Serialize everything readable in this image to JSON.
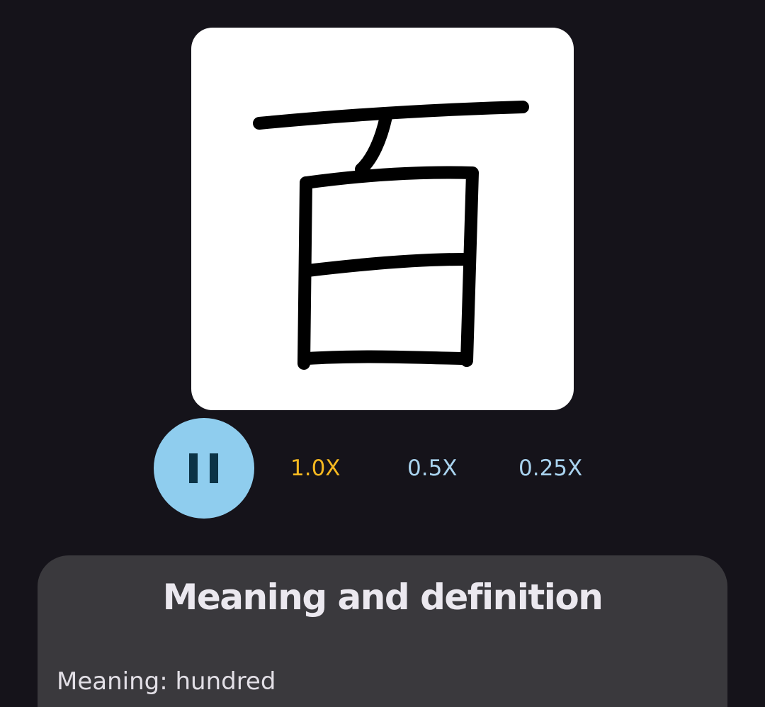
{
  "kanji": {
    "character": "百",
    "stroke_color": "#000000",
    "card_color": "#ffffff"
  },
  "player": {
    "state": "playing",
    "pause_icon": "pause-icon",
    "button_color": "#8fcdee",
    "speeds": [
      {
        "label": "1.0X",
        "selected": true,
        "color": "#f5b820"
      },
      {
        "label": "0.5X",
        "selected": false,
        "color": "#a9d3ef"
      },
      {
        "label": "0.25X",
        "selected": false,
        "color": "#a9d3ef"
      }
    ]
  },
  "definition": {
    "title": "Meaning and definition",
    "meaning": "Meaning: hundred"
  }
}
